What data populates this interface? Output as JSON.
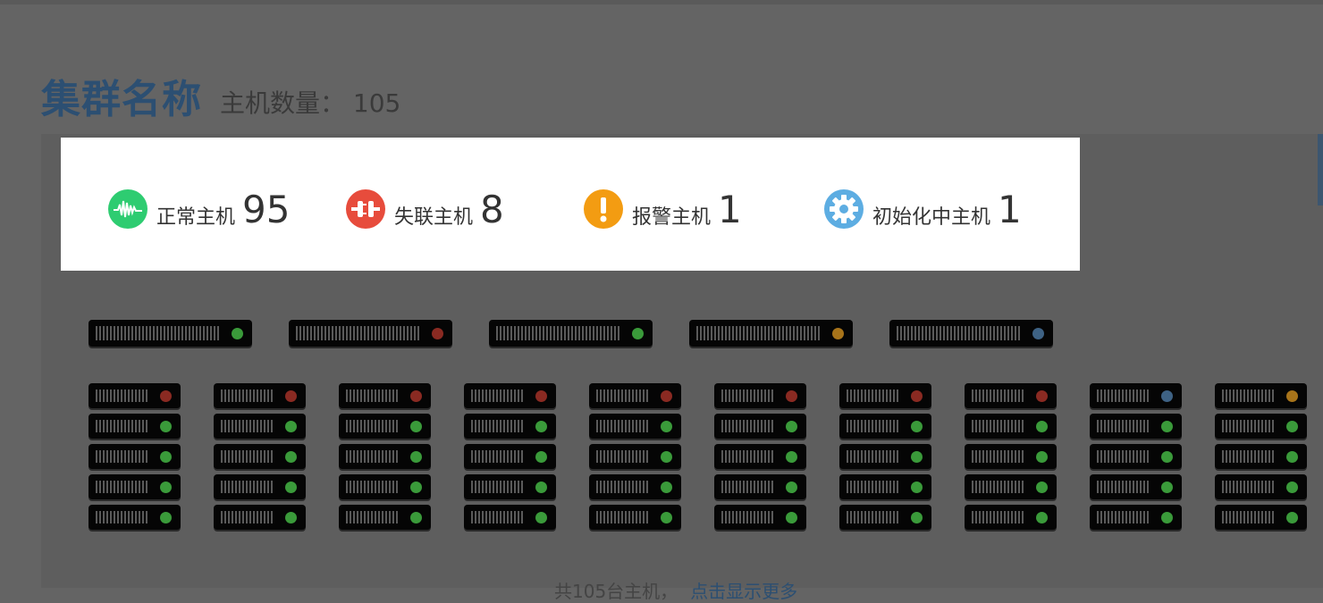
{
  "header": {
    "cluster_name": "集群名称",
    "host_count_label": "主机数量：",
    "host_count": "105"
  },
  "summary": [
    {
      "label": "正常主机",
      "count": "95",
      "icon": "pulse-icon",
      "color": "#2ecc71"
    },
    {
      "label": "失联主机",
      "count": "8",
      "icon": "unplug-icon",
      "color": "#e74c3c"
    },
    {
      "label": "报警主机",
      "count": "1",
      "icon": "alert-icon",
      "color": "#f39c12"
    },
    {
      "label": "初始化中主机",
      "count": "1",
      "icon": "gear-icon",
      "color": "#5dade2"
    }
  ],
  "status_colors": {
    "normal": "#3a9a3a",
    "lost": "#8a2a22",
    "alarm": "#a8741a",
    "init": "#3e6284"
  },
  "big_servers": [
    "normal",
    "lost",
    "normal",
    "alarm",
    "init"
  ],
  "rack_columns": [
    [
      "lost",
      "normal",
      "normal",
      "normal",
      "normal"
    ],
    [
      "lost",
      "normal",
      "normal",
      "normal",
      "normal"
    ],
    [
      "lost",
      "normal",
      "normal",
      "normal",
      "normal"
    ],
    [
      "lost",
      "normal",
      "normal",
      "normal",
      "normal"
    ],
    [
      "lost",
      "normal",
      "normal",
      "normal",
      "normal"
    ],
    [
      "lost",
      "normal",
      "normal",
      "normal",
      "normal"
    ],
    [
      "lost",
      "normal",
      "normal",
      "normal",
      "normal"
    ],
    [
      "lost",
      "normal",
      "normal",
      "normal",
      "normal"
    ],
    [
      "init",
      "normal",
      "normal",
      "normal",
      "normal"
    ],
    [
      "alarm",
      "normal",
      "normal",
      "normal",
      "normal"
    ]
  ],
  "footer": {
    "text": "共105台主机，",
    "more_link": "点击显示更多"
  }
}
